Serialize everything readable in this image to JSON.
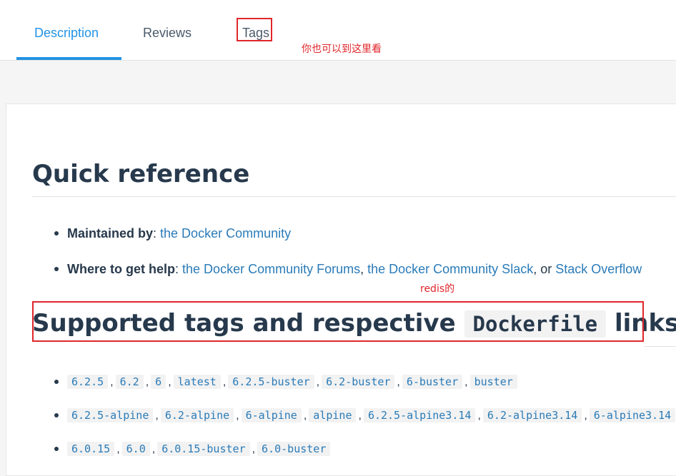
{
  "tabs": [
    {
      "label": "Description",
      "active": true
    },
    {
      "label": "Reviews",
      "active": false
    },
    {
      "label": "Tags",
      "active": false
    }
  ],
  "annotations": {
    "tags_note": "你也可以到这里看",
    "redis_note": "redis的"
  },
  "quick_reference": {
    "title": "Quick reference",
    "maintained_label": "Maintained by",
    "maintained_link": "the Docker Community",
    "help_label": "Where to get help",
    "help_link_forums": "the Docker Community Forums",
    "help_link_slack": "the Docker Community Slack",
    "help_or": "or",
    "help_link_so": "Stack Overflow"
  },
  "supported_tags": {
    "title_prefix": "Supported tags and respective",
    "title_code": "Dockerfile",
    "title_suffix": "links",
    "rows": [
      [
        "6.2.5",
        "6.2",
        "6",
        "latest",
        "6.2.5-buster",
        "6.2-buster",
        "6-buster",
        "buster"
      ],
      [
        "6.2.5-alpine",
        "6.2-alpine",
        "6-alpine",
        "alpine",
        "6.2.5-alpine3.14",
        "6.2-alpine3.14",
        "6-alpine3.14"
      ],
      [
        "6.0.15",
        "6.0",
        "6.0.15-buster",
        "6.0-buster"
      ]
    ]
  },
  "colors": {
    "accent": "#2393e4",
    "link": "#2a7bb8",
    "annotation": "#e0262b",
    "heading": "#27394c"
  }
}
